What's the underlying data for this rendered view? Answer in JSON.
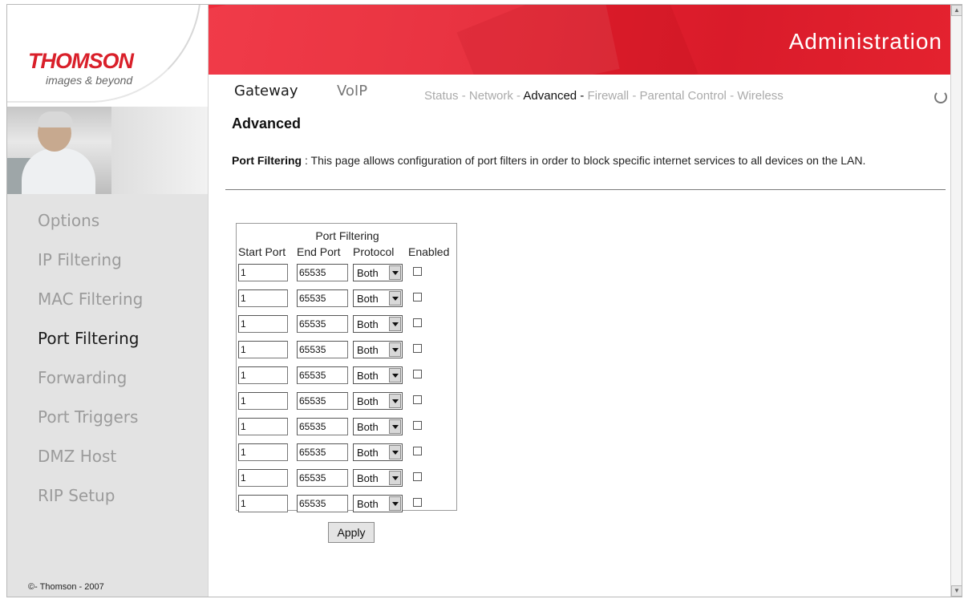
{
  "brand": {
    "logo": "THOMSON",
    "tagline": "images & beyond"
  },
  "header": {
    "title": "Administration"
  },
  "top_nav": {
    "main": [
      "Gateway",
      "VoIP"
    ],
    "sub": [
      {
        "label": "Status",
        "sep": " - "
      },
      {
        "label": "Network",
        "sep": " - "
      },
      {
        "label": "Advanced",
        "sep": " - "
      },
      {
        "label": "Firewall",
        "sep": " - "
      },
      {
        "label": "Parental Control",
        "sep": " - "
      },
      {
        "label": "Wireless",
        "sep": ""
      }
    ],
    "active_sub": "Advanced"
  },
  "sidebar": {
    "items": [
      {
        "label": "Options"
      },
      {
        "label": "IP Filtering"
      },
      {
        "label": "MAC Filtering"
      },
      {
        "label": "Port Filtering"
      },
      {
        "label": "Forwarding"
      },
      {
        "label": "Port Triggers"
      },
      {
        "label": "DMZ Host"
      },
      {
        "label": "RIP Setup"
      }
    ],
    "active": "Port Filtering",
    "copyright": "©- Thomson - 2007"
  },
  "content": {
    "heading": "Advanced",
    "description_label": "Port Filtering",
    "description_sep": " : ",
    "description": "This page allows configuration of port filters in order to block specific internet services to all devices on the LAN."
  },
  "port_filtering": {
    "title": "Port Filtering",
    "columns": [
      "Start Port",
      "End Port",
      "Protocol",
      "Enabled"
    ],
    "rows": [
      {
        "start": "1",
        "end": "65535",
        "protocol": "Both",
        "enabled": false
      },
      {
        "start": "1",
        "end": "65535",
        "protocol": "Both",
        "enabled": false
      },
      {
        "start": "1",
        "end": "65535",
        "protocol": "Both",
        "enabled": false
      },
      {
        "start": "1",
        "end": "65535",
        "protocol": "Both",
        "enabled": false
      },
      {
        "start": "1",
        "end": "65535",
        "protocol": "Both",
        "enabled": false
      },
      {
        "start": "1",
        "end": "65535",
        "protocol": "Both",
        "enabled": false
      },
      {
        "start": "1",
        "end": "65535",
        "protocol": "Both",
        "enabled": false
      },
      {
        "start": "1",
        "end": "65535",
        "protocol": "Both",
        "enabled": false
      },
      {
        "start": "1",
        "end": "65535",
        "protocol": "Both",
        "enabled": false
      },
      {
        "start": "1",
        "end": "65535",
        "protocol": "Both",
        "enabled": false
      }
    ],
    "apply_label": "Apply"
  },
  "colors": {
    "brand_red": "#e51f2e",
    "sidebar_bg": "#e3e3e3",
    "inactive_text": "#9b9b9b"
  }
}
